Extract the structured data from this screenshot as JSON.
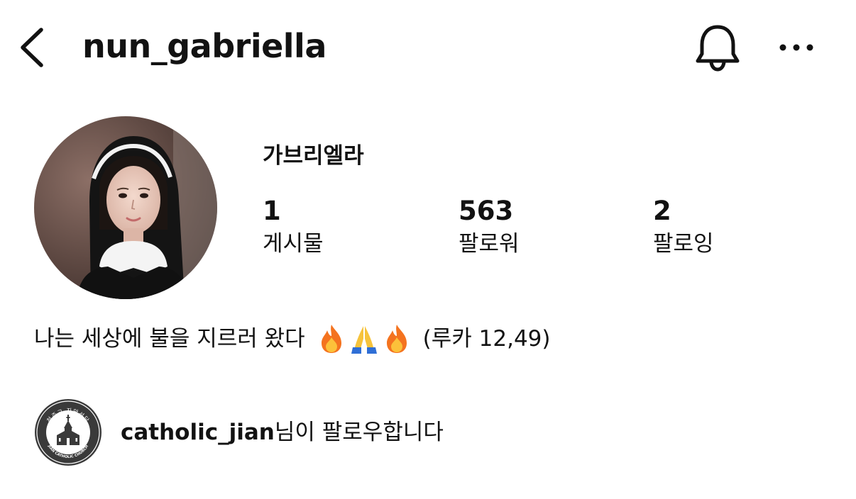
{
  "header": {
    "username": "nun_gabriella",
    "icons": {
      "back": "chevron-left-icon",
      "notifications": "bell-icon",
      "more": "more-horizontal-icon"
    }
  },
  "profile": {
    "display_name": "가브리엘라",
    "stats": {
      "posts": {
        "count": "1",
        "label": "게시물"
      },
      "followers": {
        "count": "563",
        "label": "팔로워"
      },
      "following": {
        "count": "2",
        "label": "팔로잉"
      }
    }
  },
  "bio": {
    "text": "나는 세상에 불을 지르러 왔다",
    "emojis": [
      "fire-emoji",
      "praying-hands-emoji",
      "fire-emoji"
    ],
    "reference": "(루카 12,49)"
  },
  "followed_by": {
    "logo_text_top": "천주교 지안성당",
    "logo_text_bottom": "JIAN CATHOLIC CHURCH",
    "username": "catholic_jian",
    "suffix": "님이 팔로우합니다"
  },
  "colors": {
    "text": "#121212",
    "background": "#ffffff",
    "habit_black": "#141414",
    "collar_white": "#f4f4f4",
    "fire_orange": "#f4731f",
    "hands_yellow": "#f6c33c",
    "sleeve_blue": "#2f6fd6"
  }
}
